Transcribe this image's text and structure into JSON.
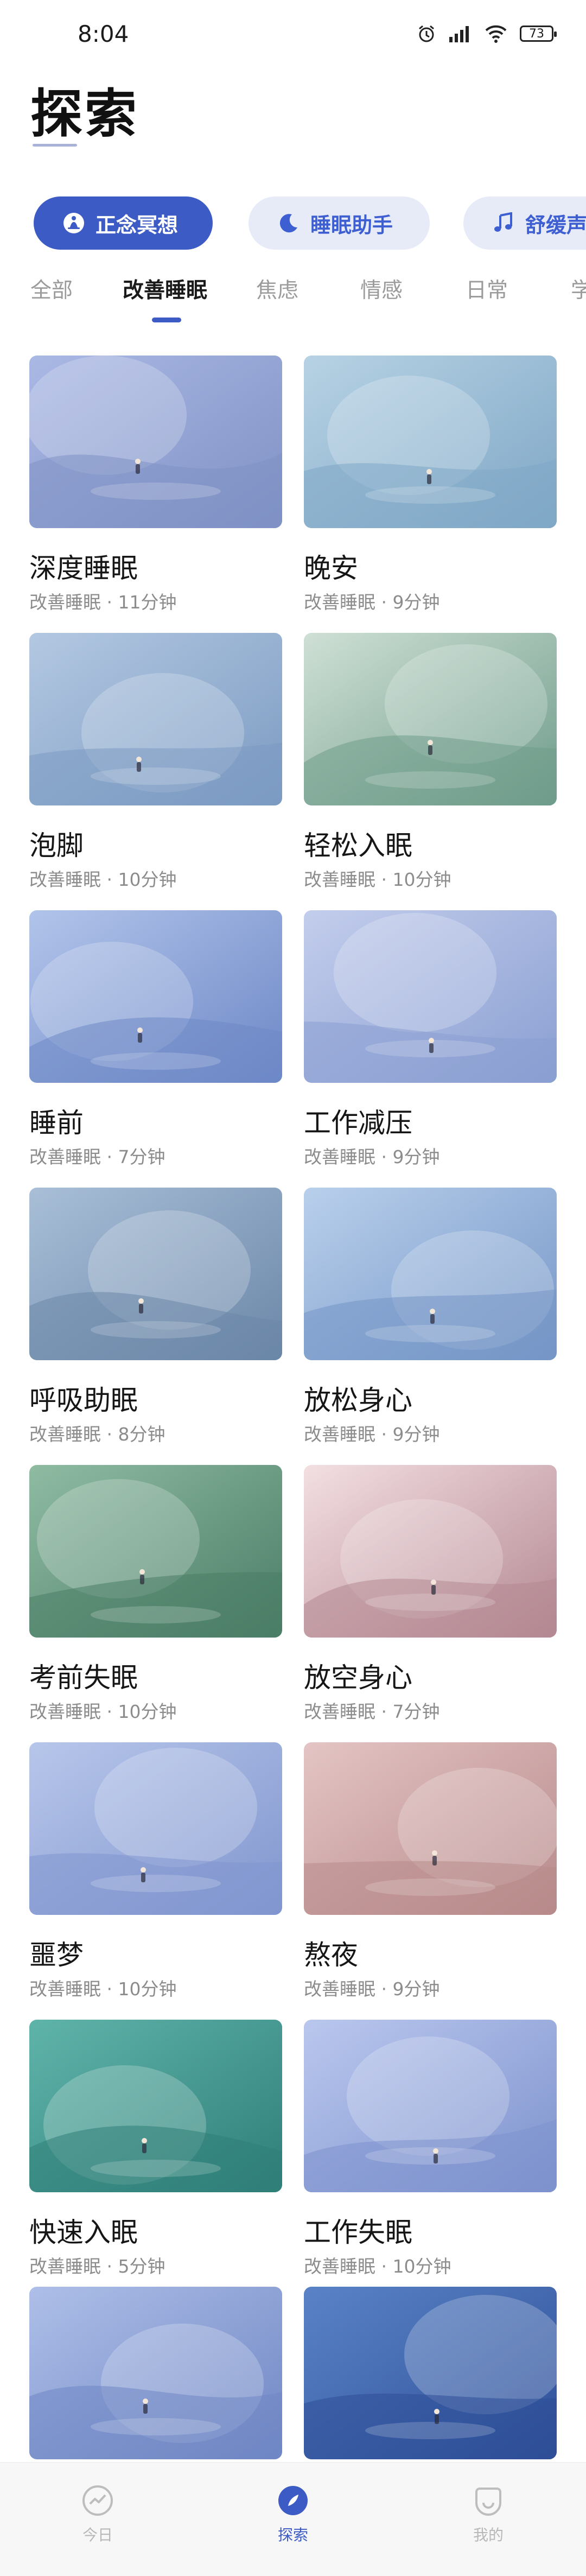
{
  "status_bar": {
    "time": "8:04",
    "battery": "73"
  },
  "page": {
    "title": "探索"
  },
  "chips": [
    {
      "label": "正念冥想",
      "icon": "meditation-icon"
    },
    {
      "label": "睡眠助手",
      "icon": "moon-icon"
    },
    {
      "label": "舒缓声",
      "icon": "music-note-icon"
    }
  ],
  "tabs": [
    "全部",
    "改善睡眠",
    "焦虑",
    "情感",
    "日常",
    "学"
  ],
  "active_tab": "改善睡眠",
  "cards": [
    {
      "title": "深度睡眠",
      "meta": "改善睡眠 · 11分钟",
      "palette": [
        "#aab8e4",
        "#7f91c4"
      ]
    },
    {
      "title": "晚安",
      "meta": "改善睡眠 · 9分钟",
      "palette": [
        "#b7d2e4",
        "#7fa7c6"
      ]
    },
    {
      "title": "泡脚",
      "meta": "改善睡眠 · 10分钟",
      "palette": [
        "#b3c8e2",
        "#7c9bc2"
      ]
    },
    {
      "title": "轻松入眠",
      "meta": "改善睡眠 · 10分钟",
      "palette": [
        "#cfe0d5",
        "#6f9c8b"
      ]
    },
    {
      "title": "睡前",
      "meta": "改善睡眠 · 7分钟",
      "palette": [
        "#b1c4ea",
        "#6e88c7"
      ]
    },
    {
      "title": "工作减压",
      "meta": "改善睡眠 · 9分钟",
      "palette": [
        "#c3cdec",
        "#8a9fd2"
      ]
    },
    {
      "title": "呼吸助眠",
      "meta": "改善睡眠 · 8分钟",
      "palette": [
        "#a9bfd8",
        "#6b87a8"
      ]
    },
    {
      "title": "放松身心",
      "meta": "改善睡眠 · 9分钟",
      "palette": [
        "#b9d0ec",
        "#7596c7"
      ]
    },
    {
      "title": "考前失眠",
      "meta": "改善睡眠 · 10分钟",
      "palette": [
        "#8fbba3",
        "#4b7d66"
      ]
    },
    {
      "title": "放空身心",
      "meta": "改善睡眠 · 7分钟",
      "palette": [
        "#f3dfe2",
        "#b48892"
      ]
    },
    {
      "title": "噩梦",
      "meta": "改善睡眠 · 10分钟",
      "palette": [
        "#b7c6ea",
        "#8196cf"
      ]
    },
    {
      "title": "熬夜",
      "meta": "改善睡眠 · 9分钟",
      "palette": [
        "#e4c4c4",
        "#b88a8b"
      ]
    },
    {
      "title": "快速入眠",
      "meta": "改善睡眠 · 5分钟",
      "palette": [
        "#5fb4aa",
        "#2f7f78"
      ]
    },
    {
      "title": "工作失眠",
      "meta": "改善睡眠 · 10分钟",
      "palette": [
        "#bac7ee",
        "#7d92cd"
      ]
    },
    {
      "title": "",
      "meta": "",
      "palette": [
        "#aebfe8",
        "#6f86c4"
      ]
    },
    {
      "title": "",
      "meta": "",
      "palette": [
        "#5a83c7",
        "#2e4f98"
      ]
    }
  ],
  "bottom_nav": [
    {
      "label": "今日",
      "icon": "trend-icon"
    },
    {
      "label": "探索",
      "icon": "compass-leaf-icon"
    },
    {
      "label": "我的",
      "icon": "profile-face-icon"
    }
  ],
  "active_nav": "探索",
  "colors": {
    "accent": "#3c5bc4",
    "chip_bg": "#e7ebf8",
    "muted": "#8c8c8c"
  }
}
